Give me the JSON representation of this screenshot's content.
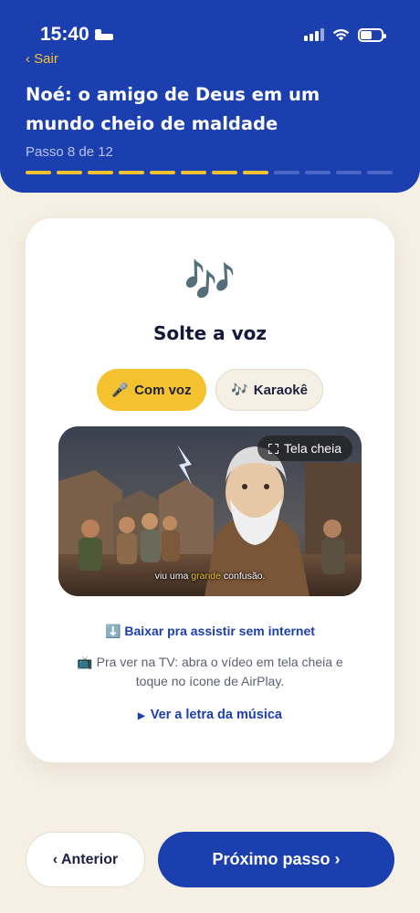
{
  "status_bar": {
    "time": "15:40"
  },
  "header": {
    "back_label": "‹ Sair",
    "title": "Noé: o amigo de Deus em um mundo cheio de maldade",
    "step_label": "Passo 8 de 12",
    "progress": {
      "current": 8,
      "total": 12
    }
  },
  "card": {
    "icon": "🎶",
    "title": "Solte a voz",
    "toggle": {
      "voice": {
        "emoji": "🎤",
        "label": "Com voz",
        "selected": true
      },
      "karaoke": {
        "emoji": "🎶",
        "label": "Karaokê",
        "selected": false
      }
    },
    "video": {
      "fullscreen_label": "Tela cheia",
      "subtitle_before": "viu uma ",
      "subtitle_highlight": "grande",
      "subtitle_after": " confusão."
    },
    "download": {
      "emoji": "⬇️",
      "label": "Baixar pra assistir sem internet"
    },
    "tv_note": {
      "emoji": "📺",
      "text": "Pra ver na TV: abra o vídeo em tela cheia e toque no ícone de AirPlay."
    },
    "lyrics_label": "Ver a letra da música"
  },
  "footer": {
    "prev_label": "‹ Anterior",
    "next_label": "Próximo passo ›"
  },
  "colors": {
    "primary": "#1c3fb0",
    "accent": "#f5c22f",
    "background": "#f5efe4"
  }
}
